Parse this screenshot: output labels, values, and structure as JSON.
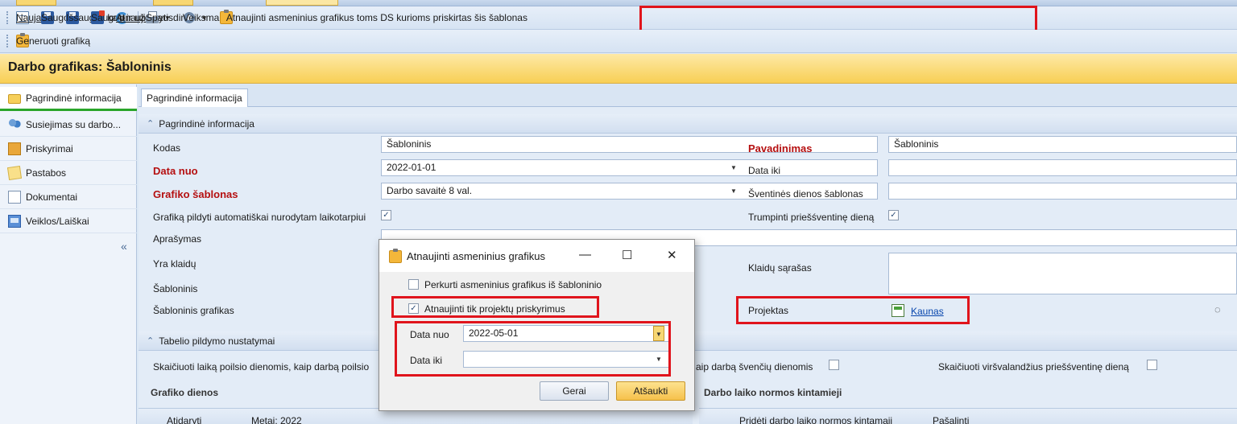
{
  "toolbar": {
    "new_label": "Naujas",
    "save_label": "Saugoti",
    "save_as_label": "Išsaugoti kaip...",
    "save_close_label": "Saugoti ir uždaryti",
    "refresh_label": "Atnaujinti",
    "print_label": "Spausdinti",
    "actions_label": "Veiksmai",
    "update_personal_label": "Atnaujinti asmeninius grafikus toms DS kurioms priskirtas šis šablonas",
    "generate_label": "Generuoti grafiką"
  },
  "page_title": "Darbo grafikas: Šabloninis",
  "left_nav": {
    "items": [
      {
        "label": "Pagrindinė informacija"
      },
      {
        "label": "Susiejimas su darbo..."
      },
      {
        "label": "Priskyrimai"
      },
      {
        "label": "Pastabos"
      },
      {
        "label": "Dokumentai"
      },
      {
        "label": "Veiklos/Laiškai"
      }
    ],
    "collapse_glyph": "«"
  },
  "tab": {
    "label": "Pagrindinė informacija"
  },
  "section_main": {
    "title": "Pagrindinė informacija"
  },
  "form": {
    "kodas_label": "Kodas",
    "kodas_value": "Šabloninis",
    "pavadinimas_label": "Pavadinimas",
    "pavadinimas_value": "Šabloninis",
    "data_nuo_label": "Data nuo",
    "data_nuo_value": "2022-01-01",
    "data_iki_label": "Data iki",
    "data_iki_value": "",
    "grafiko_sablonas_label": "Grafiko šablonas",
    "grafiko_sablonas_value": "Darbo savaitė 8 val.",
    "sventines_label": "Šventinės dienos šablonas",
    "sventines_value": "",
    "auto_fill_label": "Grafiką pildyti automatiškai nurodytam laikotarpiui",
    "auto_fill_checked": true,
    "shorten_label": "Trumpinti priešśventinę dieną",
    "shorten_checked": true,
    "aprasymas_label": "Aprašymas",
    "yra_klaidu_label": "Yra klaidų",
    "klaidu_sarasas_label": "Klaidų sąrašas",
    "sabloninis_label": "Šabloninis",
    "sabloninis_grafikas_label": "Šabloninis grafikas",
    "projektas_label": "Projektas",
    "projektas_value": "Kaunas"
  },
  "section_tabelio": {
    "title": "Tabelio pildymo nustatymai",
    "rest_days_label": "Skaičiuoti laiką poilsio dienomis, kaip darbą poilsio",
    "holidays_label": "aip darbą švenčių dienomis",
    "overtime_label": "Skaičiuoti viršvalandžius priešśventinę dieną"
  },
  "bottom": {
    "grafiko_dienos": "Grafiko dienos",
    "normos_kintamieji": "Darbo laiko normos kintamieji",
    "atidaryti_label": "Atidaryti",
    "metai_label": "Metai: 2022",
    "prideti_label": "Pridėti darbo laiko normos kintamąjį",
    "pasalinti_label": "Pašalinti"
  },
  "dialog": {
    "title": "Atnaujinti asmeninius grafikus",
    "minimize": "—",
    "maximize": "☐",
    "close": "✕",
    "copy_label": "Perkurti asmeninius grafikus iš šabloninio",
    "copy_checked": false,
    "projects_only_label": "Atnaujinti tik projektų priskyrimus",
    "projects_only_checked": true,
    "data_nuo_label": "Data nuo",
    "data_nuo_value": "2022-05-01",
    "data_iki_label": "Data iki",
    "data_iki_value": "",
    "ok_label": "Gerai",
    "cancel_label": "Atšaukti"
  },
  "colors": {
    "highlight": "#e0141c",
    "title_band": "#f8cf55",
    "required_label": "#b50f10",
    "active_underline": "#2aa52a"
  },
  "icons": {
    "new": "document-icon",
    "save": "floppy-icon",
    "save_as": "floppy-icon",
    "save_close": "floppy-close-icon",
    "refresh": "refresh-icon",
    "print": "printer-icon",
    "actions": "gear-icon",
    "update": "clipboard-icon",
    "generate": "clipboard-icon",
    "project": "project-icon"
  }
}
